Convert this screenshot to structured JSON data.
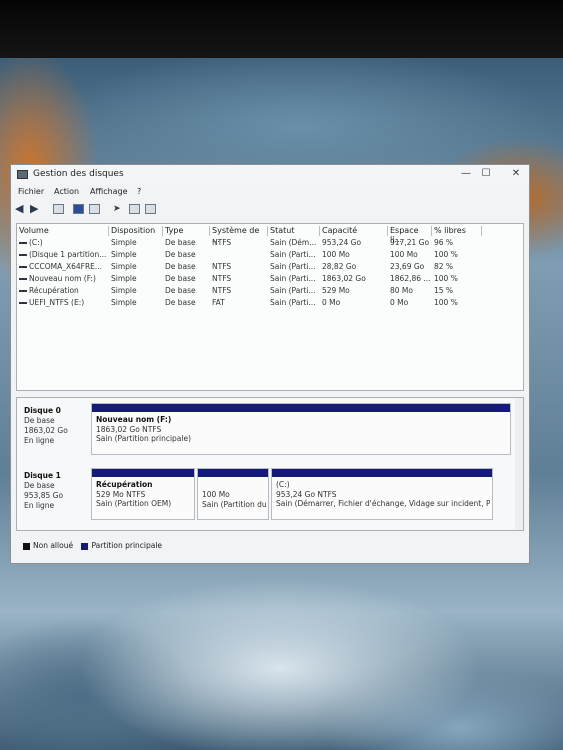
{
  "window": {
    "title": "Gestion des disques",
    "controls": {
      "minimize": "—",
      "maximize": "☐",
      "close": "✕"
    }
  },
  "menu": [
    "Fichier",
    "Action",
    "Affichage",
    "?"
  ],
  "toolbar_icons": [
    "back-arrow-icon",
    "forward-arrow-icon",
    "properties-icon",
    "help-icon",
    "disk-view-icon",
    "connect-icon",
    "check-icon",
    "window-icon"
  ],
  "volume_table": {
    "columns": [
      "Volume",
      "Disposition",
      "Type",
      "Système de ...",
      "Statut",
      "Capacité",
      "Espace li...",
      "% libres"
    ],
    "rows": [
      [
        "(C:)",
        "Simple",
        "De base",
        "NTFS",
        "Sain (Dém...",
        "953,24 Go",
        "917,21 Go",
        "96 %"
      ],
      [
        "(Disque 1 partition...",
        "Simple",
        "De base",
        "",
        "Sain (Parti...",
        "100 Mo",
        "100 Mo",
        "100 %"
      ],
      [
        "CCCOMA_X64FRE...",
        "Simple",
        "De base",
        "NTFS",
        "Sain (Parti...",
        "28,82 Go",
        "23,69 Go",
        "82 %"
      ],
      [
        "Nouveau nom (F:)",
        "Simple",
        "De base",
        "NTFS",
        "Sain (Parti...",
        "1863,02 Go",
        "1862,86 ...",
        "100 %"
      ],
      [
        "Récupération",
        "Simple",
        "De base",
        "NTFS",
        "Sain (Parti...",
        "529 Mo",
        "80 Mo",
        "15 %"
      ],
      [
        "UEFI_NTFS (E:)",
        "Simple",
        "De base",
        "FAT",
        "Sain (Parti...",
        "0 Mo",
        "0 Mo",
        "100 %"
      ]
    ]
  },
  "disks": [
    {
      "name": "Disque 0",
      "kind": "De base",
      "size": "1863,02 Go",
      "state": "En ligne",
      "partitions": [
        {
          "title": "Nouveau nom (F:)",
          "line2": "1863,02 Go NTFS",
          "line3": "Sain (Partition principale)"
        }
      ]
    },
    {
      "name": "Disque 1",
      "kind": "De base",
      "size": "953,85 Go",
      "state": "En ligne",
      "partitions": [
        {
          "title": "Récupération",
          "line2": "529 Mo NTFS",
          "line3": "Sain (Partition OEM)"
        },
        {
          "title": "",
          "line2": "100 Mo",
          "line3": "Sain (Partition du"
        },
        {
          "title": "(C:)",
          "line2": "953,24 Go NTFS",
          "line3": "Sain (Démarrer, Fichier d'échange, Vidage sur incident, Partit"
        }
      ]
    }
  ],
  "legend": [
    {
      "label": "Non alloué",
      "color": "#111111"
    },
    {
      "label": "Partition principale",
      "color": "#151a78"
    }
  ]
}
